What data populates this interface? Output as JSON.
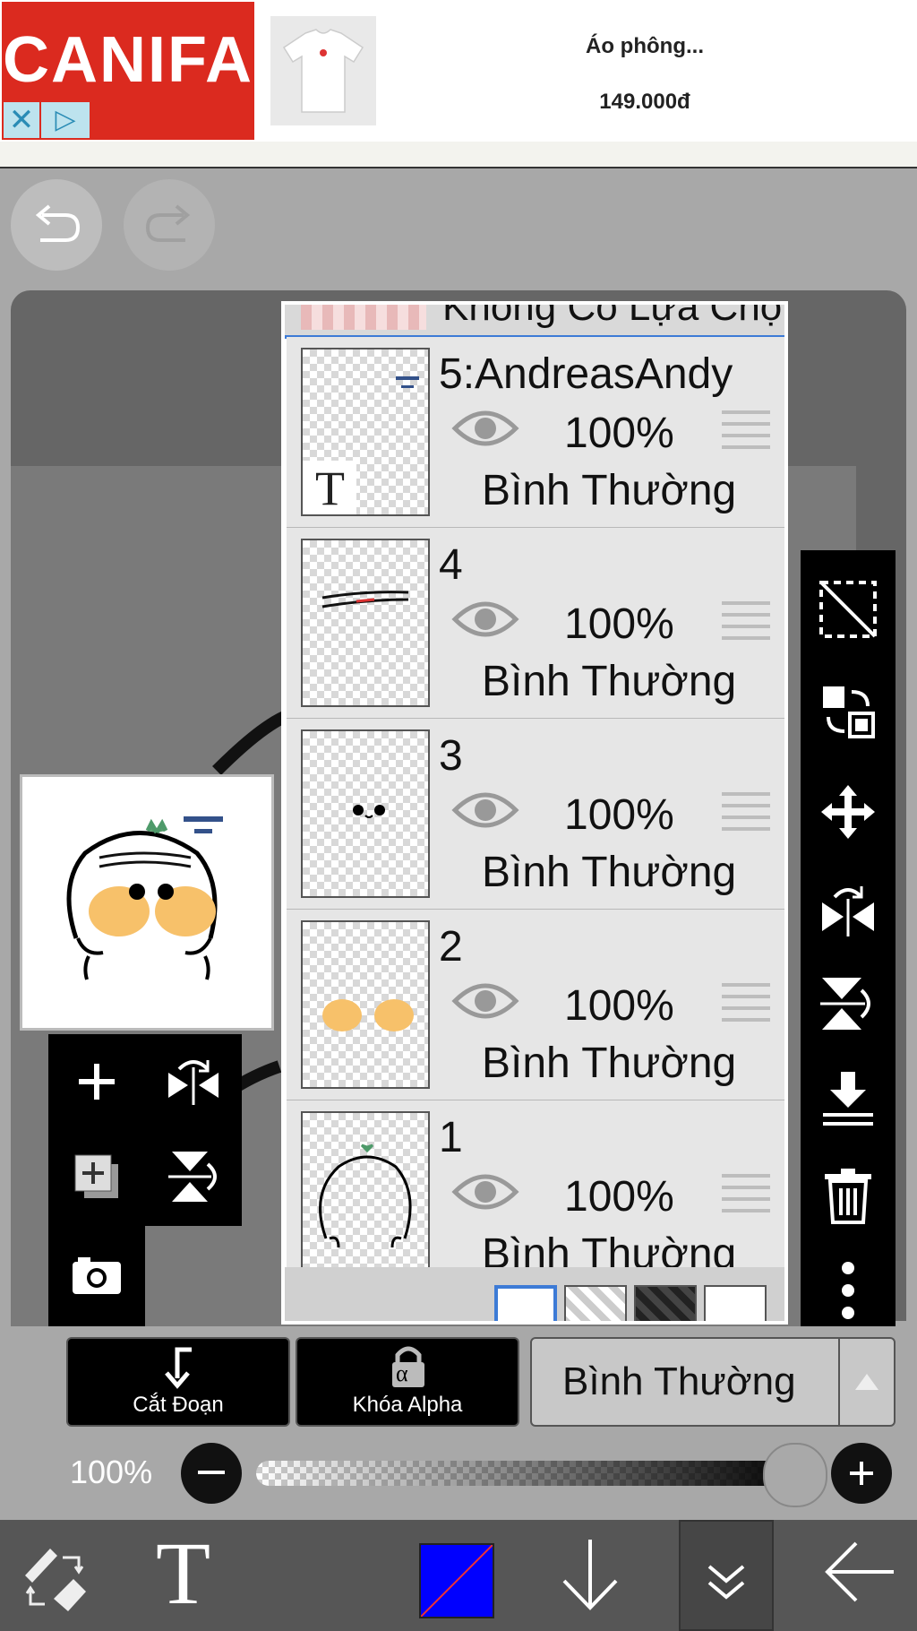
{
  "ad": {
    "brand": "CANIFA",
    "title": "Áo phông...",
    "price": "149.000đ",
    "icons": [
      "close-icon",
      "adchoices-icon"
    ]
  },
  "history": {
    "icons": [
      "undo-icon",
      "redo-icon"
    ]
  },
  "layers": {
    "top_partial_label": "Không Có Lựa Chọn",
    "items": [
      {
        "name": "5:AndreasAndy",
        "opacity": "100%",
        "blend": "Bình Thường",
        "thumb": "text",
        "thumb_text": "T"
      },
      {
        "name": "4",
        "opacity": "100%",
        "blend": "Bình Thường",
        "thumb": "band"
      },
      {
        "name": "3",
        "opacity": "100%",
        "blend": "Bình Thường",
        "thumb": "eyes"
      },
      {
        "name": "2",
        "opacity": "100%",
        "blend": "Bình Thường",
        "thumb": "cheeks"
      },
      {
        "name": "1",
        "opacity": "100%",
        "blend": "Bình Thường",
        "thumb": "outline"
      }
    ]
  },
  "right_toolbar": {
    "icons": [
      "select-clear-icon",
      "transform-icon",
      "move-icon",
      "flip-horizontal-icon",
      "flip-vertical-icon",
      "merge-down-icon",
      "trash-icon",
      "more-icon"
    ]
  },
  "left_toolbar": {
    "icons": [
      "add-layer-icon",
      "flip-h-icon",
      "duplicate-layer-icon",
      "flip-v-icon",
      "camera-icon"
    ]
  },
  "controls": {
    "clip_label": "Cắt Đoạn",
    "alpha_label": "Khóa Alpha",
    "alpha_glyph": "α",
    "blend_mode": "Bình Thường",
    "opacity_label": "100%",
    "opacity_value": 1.0
  },
  "bottom_toolbar": {
    "text_tool": "T",
    "icons": [
      "brush-eraser-icon",
      "text-icon",
      "color-swatch",
      "arrow-down-icon",
      "collapse-icon",
      "back-arrow-icon"
    ],
    "color": "#0000ff"
  }
}
